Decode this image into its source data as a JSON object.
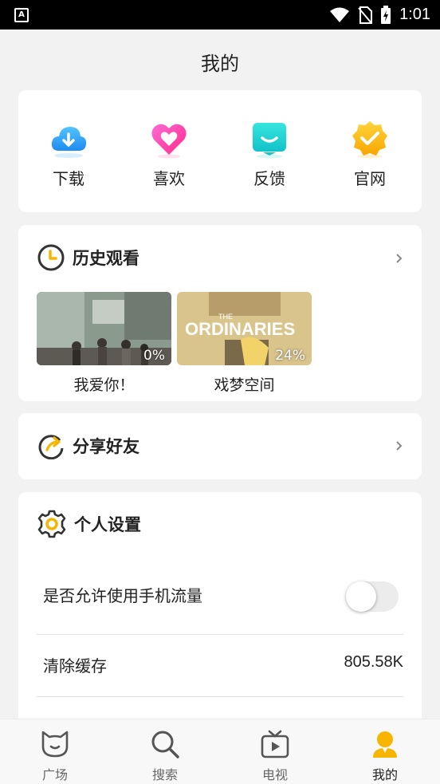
{
  "status_bar": {
    "time": "1:01"
  },
  "header": {
    "title": "我的"
  },
  "quick_actions": [
    {
      "label": "下载",
      "icon": "download-cloud-icon"
    },
    {
      "label": "喜欢",
      "icon": "heart-icon"
    },
    {
      "label": "反馈",
      "icon": "feedback-icon"
    },
    {
      "label": "官网",
      "icon": "verified-badge-icon"
    }
  ],
  "history": {
    "title": "历史观看",
    "items": [
      {
        "title": "我爱你！",
        "progress": "0%"
      },
      {
        "title": "戏梦空间",
        "progress": "24%",
        "poster_text_top": "THE",
        "poster_text": "ORDINARIES"
      }
    ]
  },
  "share": {
    "title": "分享好友"
  },
  "settings": {
    "title": "个人设置",
    "mobile_data_label": "是否允许使用手机流量",
    "mobile_data_enabled": false,
    "clear_cache_label": "清除缓存",
    "cache_size": "805.58K"
  },
  "tabs": [
    {
      "label": "广场",
      "icon": "cat-face-icon"
    },
    {
      "label": "搜索",
      "icon": "search-icon"
    },
    {
      "label": "电视",
      "icon": "tv-icon"
    },
    {
      "label": "我的",
      "icon": "user-icon",
      "active": true
    }
  ],
  "colors": {
    "accent": "#f7b500",
    "background": "#f2f2f2",
    "card": "#ffffff"
  }
}
